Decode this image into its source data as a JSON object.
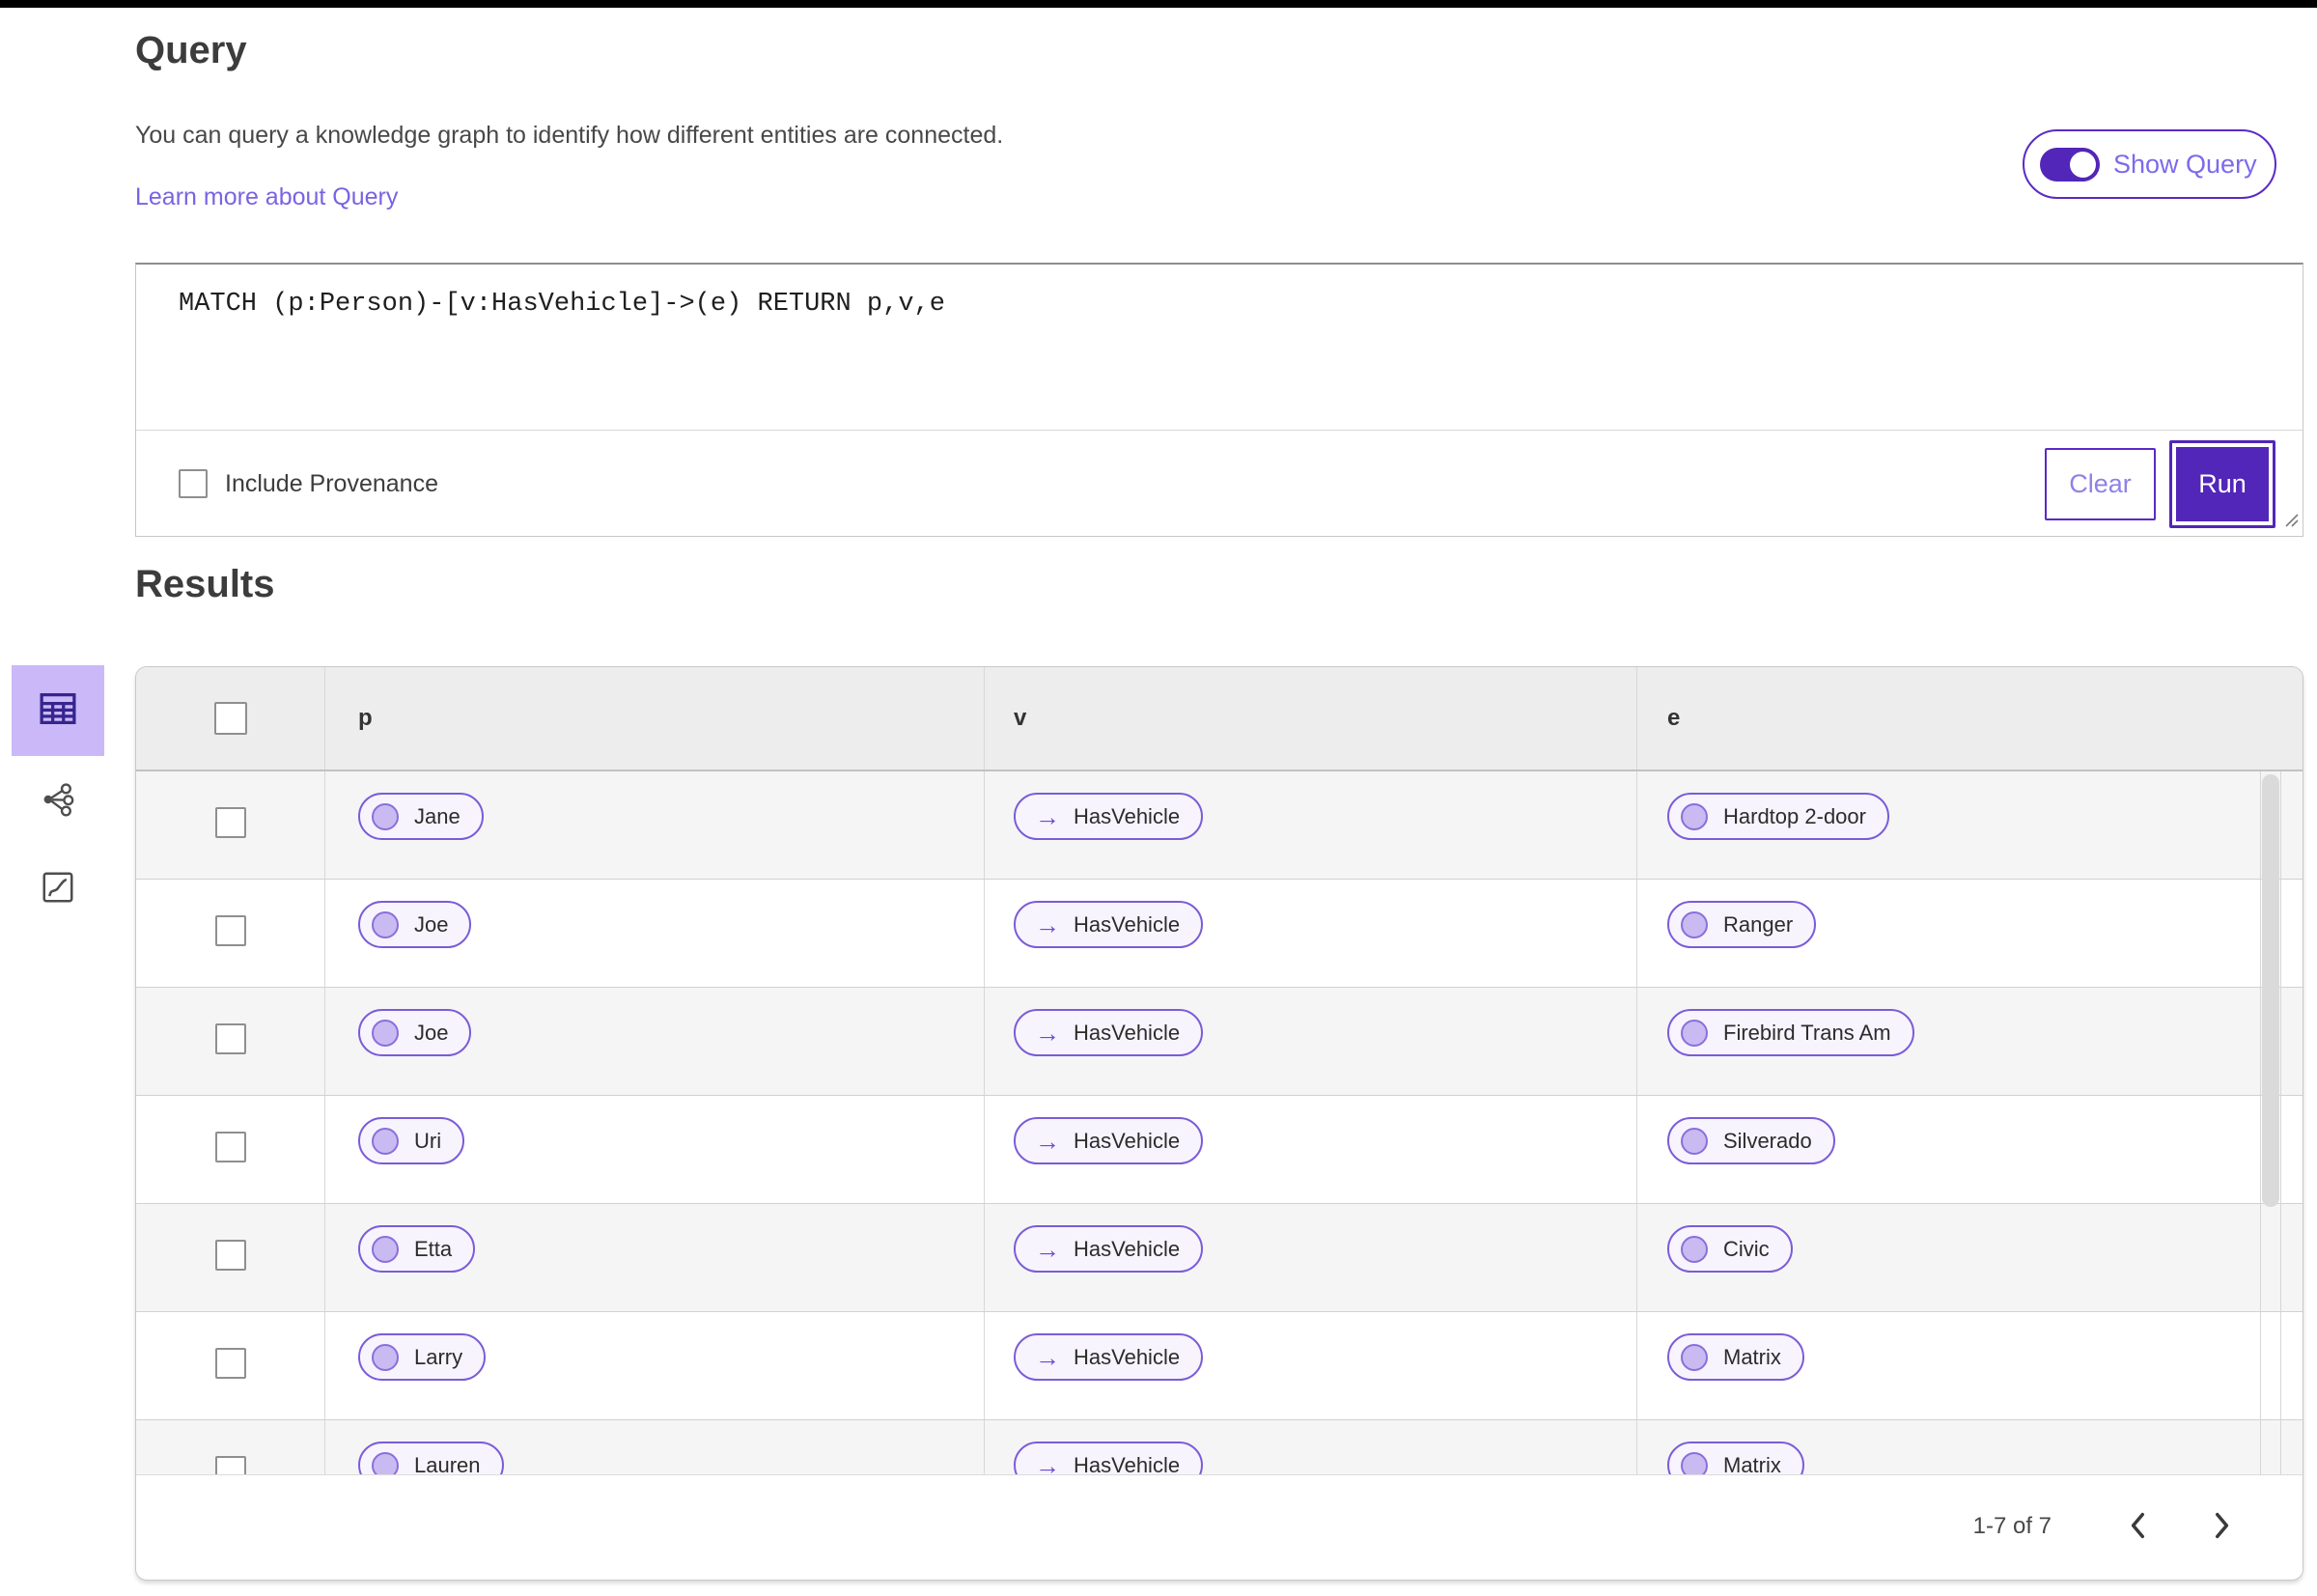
{
  "header": {
    "title": "Query",
    "description": "You can query a knowledge graph to identify how different entities are connected.",
    "learn_more_link": "Learn more about Query",
    "show_query_toggle": {
      "label": "Show Query",
      "enabled": true
    }
  },
  "query_editor": {
    "query_text": "MATCH (p:Person)-[v:HasVehicle]->(e) RETURN p,v,e",
    "include_provenance": {
      "label": "Include Provenance",
      "checked": false
    },
    "clear_button": "Clear",
    "run_button": "Run"
  },
  "view_switcher": {
    "items": [
      {
        "name": "table-view",
        "icon": "table-icon",
        "selected": true
      },
      {
        "name": "graph-view",
        "icon": "graph-icon",
        "selected": false
      },
      {
        "name": "chart-view",
        "icon": "chart-curve-icon",
        "selected": false
      }
    ]
  },
  "results": {
    "heading": "Results",
    "select_all_checked": false,
    "columns": [
      "p",
      "v",
      "e"
    ],
    "rows": [
      {
        "p": "Jane",
        "v": "HasVehicle",
        "e": "Hardtop 2-door"
      },
      {
        "p": "Joe",
        "v": "HasVehicle",
        "e": "Ranger"
      },
      {
        "p": "Joe",
        "v": "HasVehicle",
        "e": "Firebird Trans Am"
      },
      {
        "p": "Uri",
        "v": "HasVehicle",
        "e": "Silverado"
      },
      {
        "p": "Etta",
        "v": "HasVehicle",
        "e": "Civic"
      },
      {
        "p": "Larry",
        "v": "HasVehicle",
        "e": "Matrix"
      },
      {
        "p": "Lauren",
        "v": "HasVehicle",
        "e": "Matrix"
      }
    ],
    "pagination": {
      "range_label": "1-7 of 7"
    }
  },
  "icons": {
    "edge_arrow": "→",
    "prev": "chevron-left-icon",
    "next": "chevron-right-icon"
  },
  "colors": {
    "brand_purple": "#5226b8",
    "toggle_border": "#5a2ac5",
    "link_purple": "#7a63e2",
    "clear_text": "#8f81e8",
    "pill_border": "#7b5cd8",
    "pill_bg": "#f7f4fd",
    "pill_dot_fill": "#cabaf2",
    "selected_view_bg": "#cbb8f8",
    "table_header_bg": "#ededed",
    "row_alt_bg": "#f5f5f5",
    "top_bar": "#000000"
  }
}
